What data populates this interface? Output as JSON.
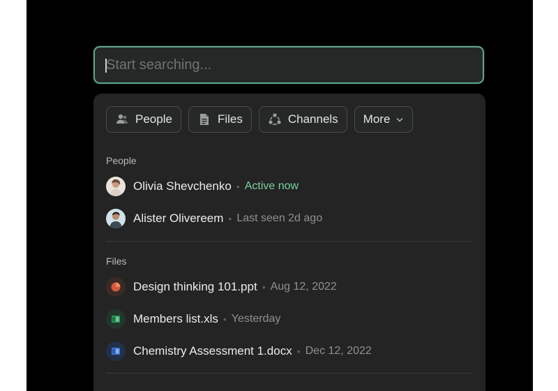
{
  "search": {
    "placeholder": "Start searching..."
  },
  "filters": [
    {
      "label": "People",
      "icon": "people-icon"
    },
    {
      "label": "Files",
      "icon": "file-icon"
    },
    {
      "label": "Channels",
      "icon": "channels-icon"
    },
    {
      "label": "More",
      "icon": "chevron-down-icon"
    }
  ],
  "people": {
    "title": "People",
    "items": [
      {
        "name": "Olivia Shevchenko",
        "status": "Active now",
        "status_color": "#7ed0a2"
      },
      {
        "name": "Alister Olivereem",
        "status": "Last seen 2d ago"
      }
    ]
  },
  "files": {
    "title": "Files",
    "items": [
      {
        "name": "Design thinking 101.ppt",
        "date": "Aug 12, 2022",
        "icon": "powerpoint-icon",
        "color": "#d2583a"
      },
      {
        "name": "Members list.xls",
        "date": "Yesterday",
        "icon": "excel-icon",
        "color": "#2f9a5c"
      },
      {
        "name": "Chemistry Assessment 1.docx",
        "date": "Dec 12, 2022",
        "icon": "word-icon",
        "color": "#3c78d8"
      }
    ]
  },
  "colors": {
    "accent": "#5fa88a",
    "panel": "#232423",
    "background": "#000000"
  }
}
